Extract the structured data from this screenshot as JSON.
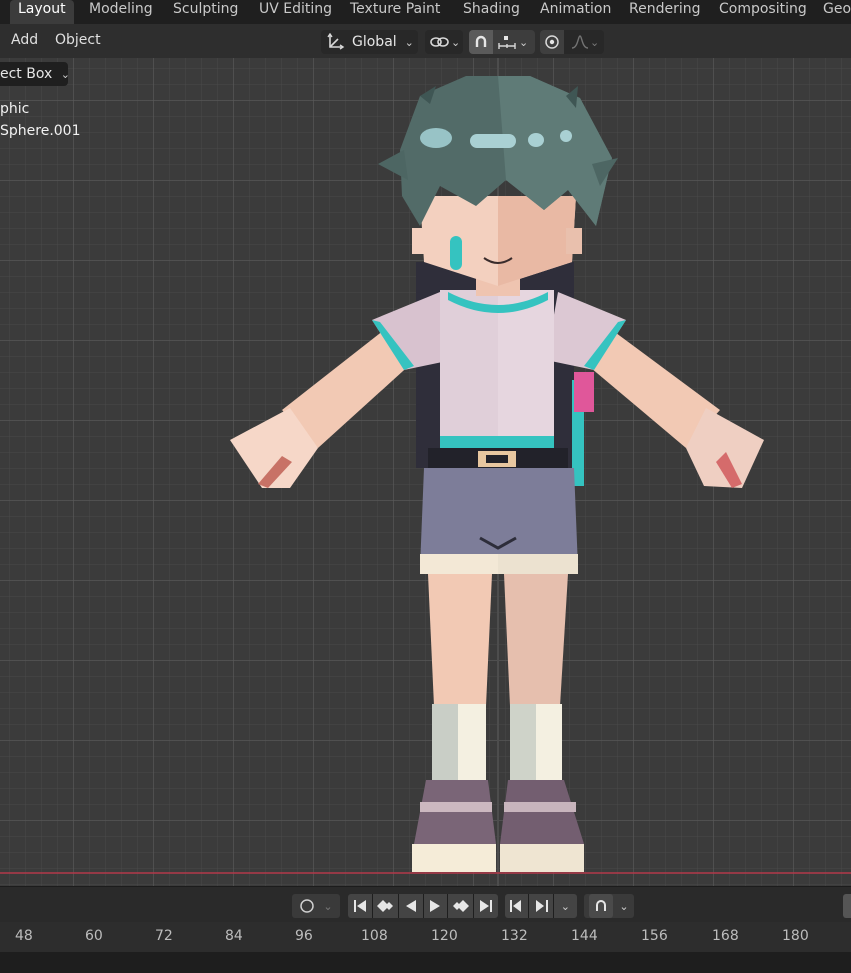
{
  "workspaces": {
    "tabs": [
      "Layout",
      "Modeling",
      "Sculpting",
      "UV Editing",
      "Texture Paint",
      "Shading",
      "Animation",
      "Rendering",
      "Compositing",
      "Geo"
    ],
    "active": "Layout"
  },
  "header": {
    "menus": [
      "Add",
      "Object"
    ],
    "orientation": "Global",
    "select_mode": "ect Box"
  },
  "overlay_info": {
    "line1": "phic",
    "line2": "Sphere.001"
  },
  "timeline": {
    "frame_ticks": [
      "48",
      "60",
      "72",
      "84",
      "96",
      "108",
      "120",
      "132",
      "144",
      "156",
      "168",
      "180"
    ]
  },
  "icons": {
    "transform_orientation": "orientation-axes-icon",
    "snap": "magnet-icon",
    "proportional": "proportional-edit-icon",
    "keyframe_record": "record-icon",
    "jump_start": "jump-to-start-icon",
    "jump_end": "jump-to-end-icon",
    "play": "play-icon"
  },
  "colors": {
    "viewport_bg": "#3b3b3b",
    "header_bg": "#2e2e2e",
    "topbar_bg": "#1f1f1f",
    "accent_red_line": "#b3394a"
  }
}
